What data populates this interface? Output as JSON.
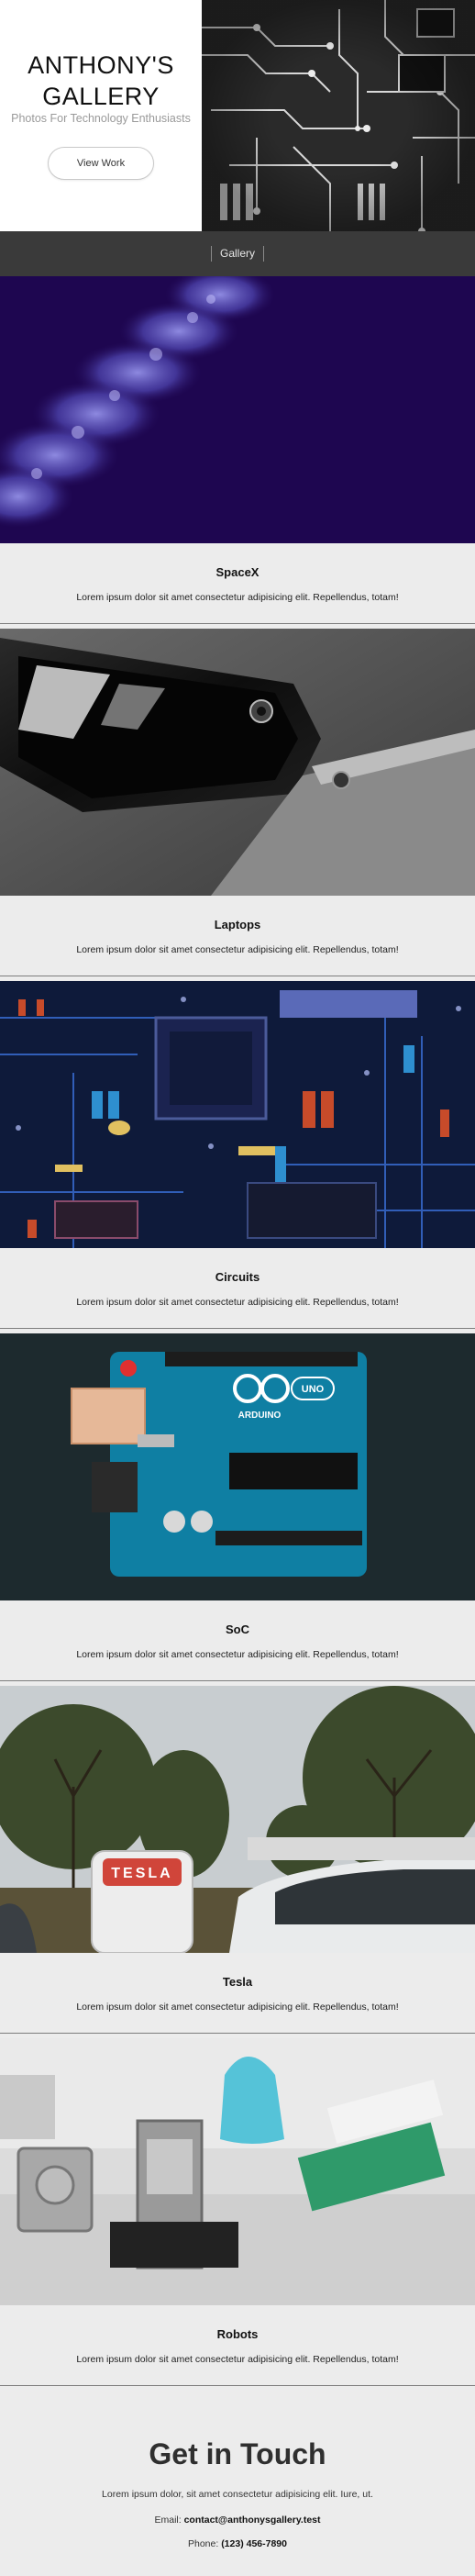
{
  "hero": {
    "title_line1": "ANTHONY'S",
    "title_line2": "GALLERY",
    "subtitle": "Photos For Technology Enthusiasts",
    "button_label": "View Work"
  },
  "nav": {
    "gallery_label": "Gallery"
  },
  "gallery": {
    "items": [
      {
        "title": "SpaceX",
        "text": "Lorem ipsum dolor sit amet consectetur adipisicing elit. Repellendus, totam!"
      },
      {
        "title": "Laptops",
        "text": "Lorem ipsum dolor sit amet consectetur adipisicing elit. Repellendus, totam!"
      },
      {
        "title": "Circuits",
        "text": "Lorem ipsum dolor sit amet consectetur adipisicing elit. Repellendus, totam!"
      },
      {
        "title": "SoC",
        "text": "Lorem ipsum dolor sit amet consectetur adipisicing elit. Repellendus, totam!"
      },
      {
        "title": "Tesla",
        "text": "Lorem ipsum dolor sit amet consectetur adipisicing elit. Repellendus, totam!"
      },
      {
        "title": "Robots",
        "text": "Lorem ipsum dolor sit amet consectetur adipisicing elit. Repellendus, totam!"
      }
    ]
  },
  "contact": {
    "title": "Get in Touch",
    "text": "Lorem ipsum dolor, sit amet consectetur adipisicing elit. Iure, ut.",
    "email_label": "Email:",
    "email_value": "contact@anthonysgallery.test",
    "phone_label": "Phone:",
    "phone_value": "(123) 456-7890"
  },
  "colors": {
    "nav_bg": "#3a3a3a",
    "page_bg": "#ececec",
    "subtitle": "#9a9a9a"
  }
}
